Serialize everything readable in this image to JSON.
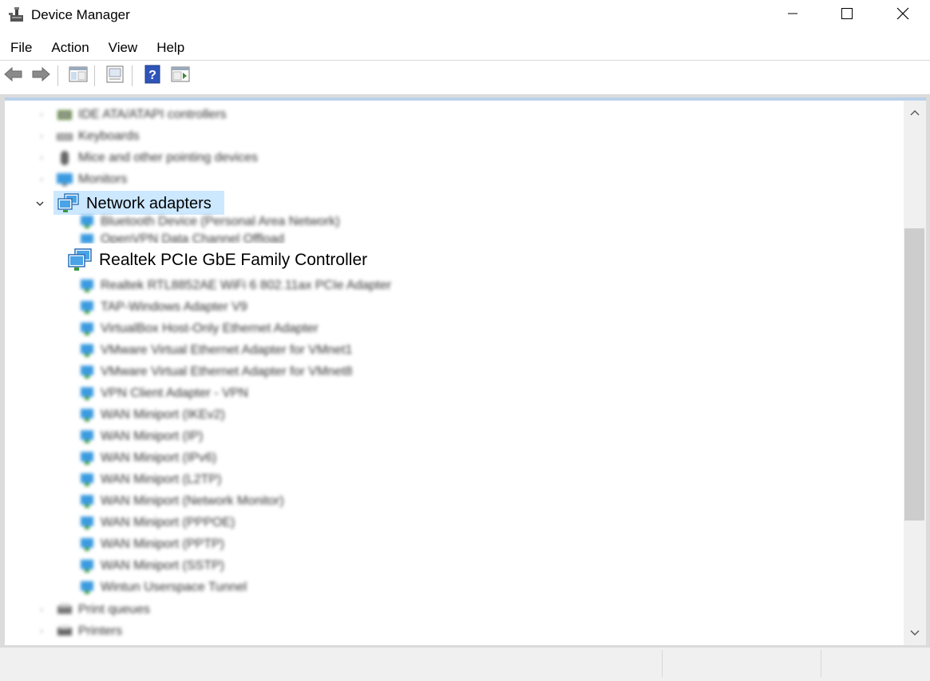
{
  "window": {
    "title": "Device Manager",
    "minimize_icon": "minimize-icon",
    "maximize_icon": "maximize-icon",
    "close_icon": "close-icon"
  },
  "menu": {
    "items": [
      "File",
      "Action",
      "View",
      "Help"
    ]
  },
  "toolbar": {
    "icons": [
      "back-arrow-icon",
      "forward-arrow-icon",
      "show-hide-console-tree-icon",
      "properties-icon",
      "help-icon",
      "show-action-pane-icon"
    ]
  },
  "tree": {
    "categories_above": [
      {
        "label": "IDE ATA/ATAPI controllers",
        "icon": "ide-controller-icon"
      },
      {
        "label": "Keyboards",
        "icon": "keyboard-icon"
      },
      {
        "label": "Mice and other pointing devices",
        "icon": "mouse-icon"
      },
      {
        "label": "Monitors",
        "icon": "monitor-icon"
      }
    ],
    "network_adapters": {
      "label": "Network adapters",
      "icon": "network-adapter-icon",
      "expanded": true,
      "selected": true,
      "children_before": [
        "Bluetooth Device (Personal Area Network)",
        "OpenVPN Data Channel Offload"
      ],
      "highlighted_child": "Realtek PCIe GbE Family Controller",
      "children_after": [
        "Realtek RTL8852AE WiFi 6 802.11ax PCIe Adapter",
        "TAP-Windows Adapter V9",
        "VirtualBox Host-Only Ethernet Adapter",
        "VMware Virtual Ethernet Adapter for VMnet1",
        "VMware Virtual Ethernet Adapter for VMnet8",
        "VPN Client Adapter - VPN",
        "WAN Miniport (IKEv2)",
        "WAN Miniport (IP)",
        "WAN Miniport (IPv6)",
        "WAN Miniport (L2TP)",
        "WAN Miniport (Network Monitor)",
        "WAN Miniport (PPPOE)",
        "WAN Miniport (PPTP)",
        "WAN Miniport (SSTP)",
        "Wintun Userspace Tunnel"
      ]
    },
    "categories_below": [
      {
        "label": "Print queues",
        "icon": "print-queue-icon"
      },
      {
        "label": "Printers",
        "icon": "printer-icon"
      }
    ]
  },
  "colors": {
    "selection": "#cce8ff",
    "adapter_icon": "#2a8fd6",
    "scroll_thumb": "#cdcdcd"
  }
}
